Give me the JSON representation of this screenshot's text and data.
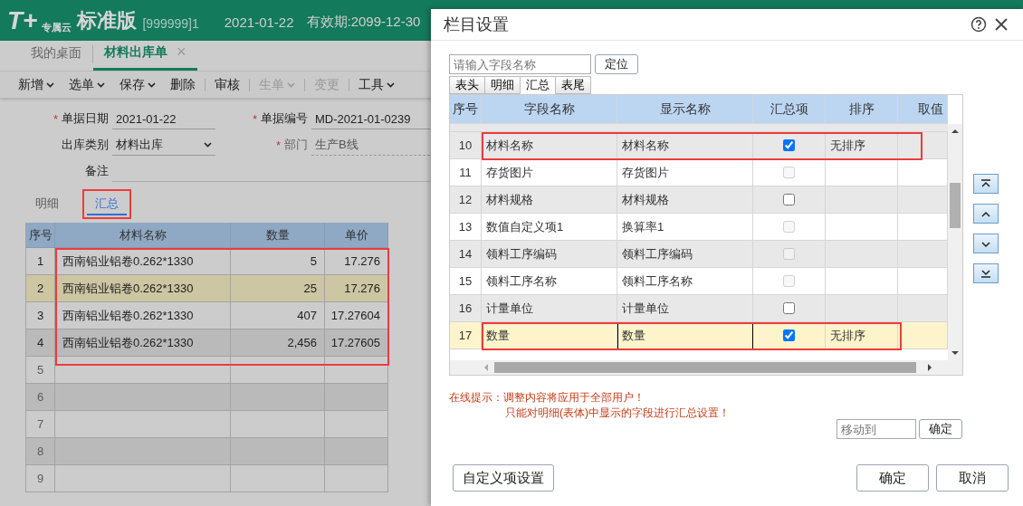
{
  "app": {
    "logo": "T+",
    "logo_sub": "专属云",
    "edition": "标准版",
    "account": "[999999]1",
    "date": "2021-01-22",
    "validity": "有效期:2099-12-30"
  },
  "tabs": [
    {
      "label": "我的桌面",
      "selected": false
    },
    {
      "label": "材料出库单",
      "selected": true,
      "close": "×"
    }
  ],
  "toolbar": [
    {
      "label": "新增",
      "menu": true,
      "disabled": false,
      "separator_after": false
    },
    {
      "label": "选单",
      "menu": true,
      "disabled": false,
      "separator_after": false
    },
    {
      "label": "保存",
      "menu": true,
      "disabled": false,
      "separator_after": false
    },
    {
      "label": "删除",
      "menu": false,
      "disabled": false,
      "separator_after": true
    },
    {
      "label": "审核",
      "menu": false,
      "disabled": false,
      "separator_after": true
    },
    {
      "label": "生单",
      "menu": true,
      "disabled": true,
      "separator_after": true
    },
    {
      "label": "变更",
      "menu": false,
      "disabled": true,
      "separator_after": true
    },
    {
      "label": "工具",
      "menu": true,
      "disabled": false,
      "separator_after": false
    }
  ],
  "form": [
    {
      "label": "单据日期",
      "marker": "*",
      "value": "2021-01-22",
      "kind": "text",
      "disabled": false
    },
    {
      "label": "单据编号",
      "marker": "*",
      "value": "MD-2021-01-0239",
      "kind": "text",
      "disabled": false
    },
    {
      "label": "出库类别",
      "value": "材料出库",
      "kind": "select",
      "disabled": false
    },
    {
      "label": "部门",
      "marker": "*",
      "value": "生产B线",
      "kind": "text",
      "disabled": true
    },
    {
      "label": "备注",
      "kind": "note",
      "disabled": false
    }
  ],
  "detail_tabs": [
    {
      "label": "明细",
      "selected": false,
      "highlighted": false
    },
    {
      "label": "汇总",
      "selected": true,
      "highlighted": true
    }
  ],
  "table": {
    "columns": [
      "序号",
      "材料名称",
      "数量",
      "单价"
    ],
    "rows": [
      {
        "index": "1",
        "name": "西南铝业铝卷0.262*1330",
        "qty": "5",
        "price": "17.276",
        "selected": false,
        "highlighted": true
      },
      {
        "index": "2",
        "name": "西南铝业铝卷0.262*1330",
        "qty": "25",
        "price": "17.276",
        "selected": true,
        "highlighted": true
      },
      {
        "index": "3",
        "name": "西南铝业铝卷0.262*1330",
        "qty": "407",
        "price": "17.27604",
        "selected": false,
        "highlighted": true
      },
      {
        "index": "4",
        "name": "西南铝业铝卷0.262*1330",
        "qty": "2,456",
        "price": "17.27605",
        "selected": false,
        "highlighted": true
      },
      {
        "index": "5",
        "selected": false,
        "highlighted": false
      },
      {
        "index": "6",
        "selected": false,
        "highlighted": false
      },
      {
        "index": "7",
        "selected": false,
        "highlighted": false
      },
      {
        "index": "8",
        "selected": false,
        "highlighted": false
      },
      {
        "index": "9",
        "selected": false,
        "highlighted": false
      }
    ]
  },
  "dialog": {
    "title": "栏目设置",
    "search": {
      "placeholder": "请输入字段名称"
    },
    "locate_button": "定位",
    "tabs": [
      {
        "label": "表头",
        "selected": false
      },
      {
        "label": "明细",
        "selected": false
      },
      {
        "label": "汇总",
        "selected": true
      },
      {
        "label": "表尾",
        "selected": false
      }
    ],
    "columns": [
      "序号",
      "字段名称",
      "显示名称",
      "汇总项",
      "排序",
      "取值"
    ],
    "rows": [
      {
        "index": "10",
        "field": "材料名称",
        "display": "材料名称",
        "checked": true,
        "disabled": false,
        "sort": "无排序",
        "selected": false,
        "editing": false,
        "highlighted": true
      },
      {
        "index": "11",
        "field": "存货图片",
        "display": "存货图片",
        "checked": false,
        "disabled": true,
        "selected": false,
        "editing": false,
        "highlighted": false
      },
      {
        "index": "12",
        "field": "材料规格",
        "display": "材料规格",
        "checked": false,
        "disabled": false,
        "selected": false,
        "editing": false,
        "highlighted": false
      },
      {
        "index": "13",
        "field": "数值自定义项1",
        "display": "换算率1",
        "checked": false,
        "disabled": true,
        "selected": false,
        "editing": false,
        "highlighted": false
      },
      {
        "index": "14",
        "field": "领料工序编码",
        "display": "领料工序编码",
        "checked": false,
        "disabled": true,
        "selected": false,
        "editing": false,
        "highlighted": false
      },
      {
        "index": "15",
        "field": "领料工序名称",
        "display": "领料工序名称",
        "checked": false,
        "disabled": true,
        "selected": false,
        "editing": false,
        "highlighted": false
      },
      {
        "index": "16",
        "field": "计量单位",
        "display": "计量单位",
        "checked": false,
        "disabled": false,
        "selected": false,
        "editing": false,
        "highlighted": false
      },
      {
        "index": "17",
        "field": "数量",
        "display": "数量",
        "checked": true,
        "disabled": false,
        "sort": "无排序",
        "selected": true,
        "editing": true,
        "highlighted": true
      }
    ],
    "move_buttons": [
      {
        "kind": "top"
      },
      {
        "kind": "up"
      },
      {
        "kind": "down"
      },
      {
        "kind": "bottom"
      }
    ],
    "notice": [
      "在线提示：调整内容将应用于全部用户！",
      "只能对明细(表体)中显示的字段进行汇总设置！"
    ],
    "move_to": {
      "placeholder": "移动到"
    },
    "move_confirm": "确定",
    "custom_button": "自定义项设置",
    "ok": "确定",
    "cancel": "取消"
  }
}
